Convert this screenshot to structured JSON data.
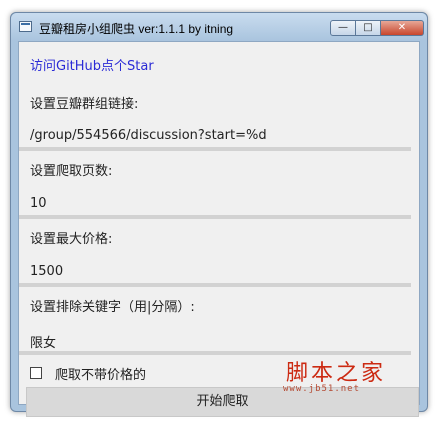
{
  "window": {
    "title": "豆瓣租房小组爬虫 ver:1.1.1 by itning",
    "min_glyph": "—",
    "max_glyph": "□",
    "close_glyph": "✕"
  },
  "link": {
    "label": "访问GitHub点个Star"
  },
  "group_link": {
    "label": "设置豆瓣群组链接:",
    "value": "/group/554566/discussion?start=%d"
  },
  "pages": {
    "label": "设置爬取页数:",
    "value": "10"
  },
  "max_price": {
    "label": "设置最大价格:",
    "value": "1500"
  },
  "keywords": {
    "label": "设置排除关键字（用|分隔）:",
    "value": "限女"
  },
  "checkbox": {
    "label": "爬取不带价格的",
    "checked": false
  },
  "start_button": {
    "label": "开始爬取"
  },
  "watermark": {
    "main": "脚本之家",
    "sub": "www.jb51.net"
  }
}
